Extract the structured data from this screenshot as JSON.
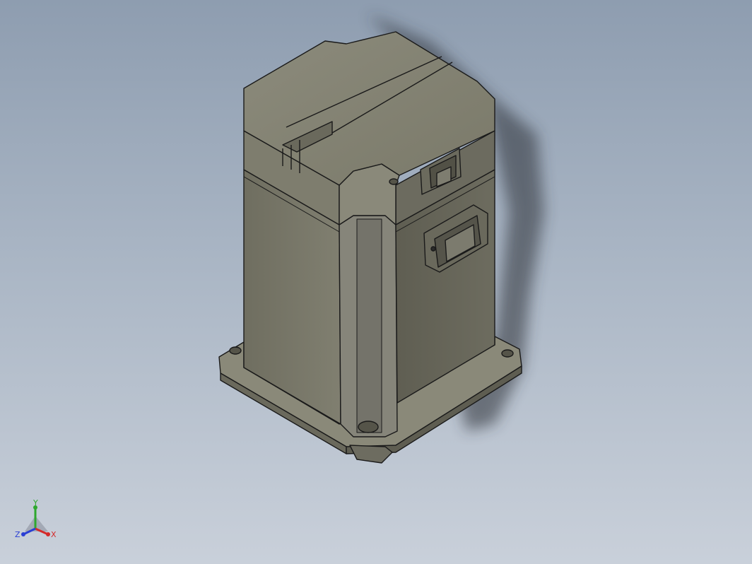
{
  "viewport": {
    "background_top": "#8e9db0",
    "background_bottom": "#c9d0da"
  },
  "model": {
    "body_color": "#7b7a6b",
    "edge_color": "#1a1a1a"
  },
  "triad": {
    "x_label": "X",
    "y_label": "Y",
    "z_label": "Z",
    "x_color": "#d42a2a",
    "y_color": "#2ea82e",
    "z_color": "#2a3fd4"
  }
}
